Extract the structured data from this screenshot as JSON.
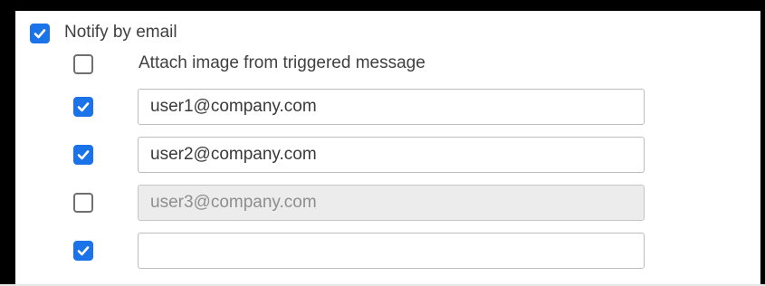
{
  "notify": {
    "label": "Notify by email",
    "checked": true
  },
  "attach": {
    "label": "Attach image from triggered message",
    "checked": false
  },
  "recipients": [
    {
      "value": "user1@company.com",
      "checked": true,
      "disabled": false
    },
    {
      "value": "user2@company.com",
      "checked": true,
      "disabled": false
    },
    {
      "value": "user3@company.com",
      "checked": false,
      "disabled": true
    },
    {
      "value": "",
      "checked": true,
      "disabled": false
    }
  ],
  "colors": {
    "checkbox_checked": "#1a73e8",
    "checkbox_border": "#6f6f6f",
    "disabled_field_bg": "#ececec"
  }
}
